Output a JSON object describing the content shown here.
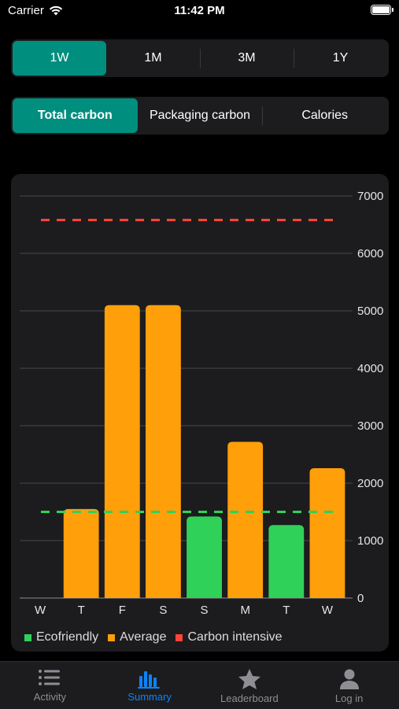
{
  "status_bar": {
    "carrier": "Carrier",
    "time": "11:42 PM"
  },
  "period_selector": [
    {
      "label": "1W",
      "selected": true
    },
    {
      "label": "1M",
      "selected": false
    },
    {
      "label": "3M",
      "selected": false
    },
    {
      "label": "1Y",
      "selected": false
    }
  ],
  "metric_selector": [
    {
      "label": "Total carbon",
      "selected": true
    },
    {
      "label": "Packaging carbon",
      "selected": false
    },
    {
      "label": "Calories",
      "selected": false
    }
  ],
  "chart_data": {
    "type": "bar",
    "categories": [
      "W",
      "T",
      "F",
      "S",
      "S",
      "M",
      "T",
      "W"
    ],
    "values": [
      0,
      1550,
      5100,
      5100,
      1420,
      2720,
      1270,
      2260
    ],
    "bar_categories": [
      "none",
      "Average",
      "Average",
      "Average",
      "Ecofriendly",
      "Average",
      "Ecofriendly",
      "Average"
    ],
    "ylim": [
      0,
      7000
    ],
    "y_ticks": [
      0,
      1000,
      2000,
      3000,
      4000,
      5000,
      6000,
      7000
    ],
    "y_axis_side": "right",
    "grid": true,
    "thresholds": [
      {
        "name": "Ecofriendly",
        "value": 1500,
        "color": "#30d158",
        "style": "dashed"
      },
      {
        "name": "Carbon intensive",
        "value": 6580,
        "color": "#ff453a",
        "style": "dashed"
      }
    ],
    "legend": [
      {
        "label": "Ecofriendly",
        "color": "#30d158"
      },
      {
        "label": "Average",
        "color": "#ff9f0a"
      },
      {
        "label": "Carbon intensive",
        "color": "#ff453a"
      }
    ],
    "legend_position": "bottom-left"
  },
  "tabs": [
    {
      "label": "Activity",
      "icon": "list-icon",
      "active": false
    },
    {
      "label": "Summary",
      "icon": "bar-chart-icon",
      "active": true
    },
    {
      "label": "Leaderboard",
      "icon": "star-icon",
      "active": false
    },
    {
      "label": "Log in",
      "icon": "person-icon",
      "active": false
    }
  ],
  "colors": {
    "accent": "#008e7f",
    "tab_active": "#0a84ff",
    "tab_inactive": "#8e8e93"
  }
}
